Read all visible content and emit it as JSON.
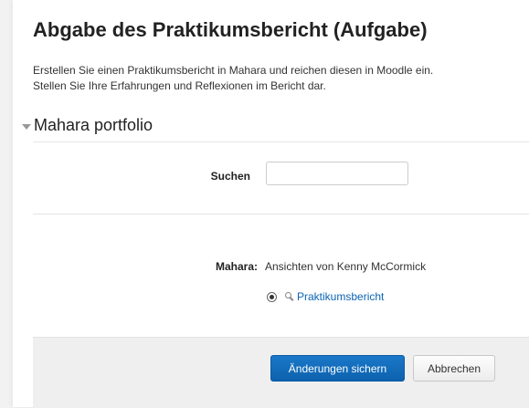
{
  "page": {
    "title": "Abgabe des Praktikumsbericht (Aufgabe)",
    "intro_lines": [
      "Erstellen Sie einen Praktikumsbericht in Mahara und reichen diesen in Moodle ein.",
      "Stellen Sie Ihre Erfahrungen und Reflexionen im Bericht dar."
    ]
  },
  "section": {
    "title": "Mahara portfolio"
  },
  "search": {
    "label": "Suchen",
    "value": "",
    "placeholder": ""
  },
  "mahara": {
    "label": "Mahara:",
    "value": "Ansichten von Kenny McCormick",
    "options": [
      {
        "label": "Praktikumsbericht",
        "selected": true
      }
    ]
  },
  "footer": {
    "save_label": "Änderungen sichern",
    "cancel_label": "Abbrechen"
  },
  "colors": {
    "primary": "#0f6cbf",
    "link": "#0b64b2",
    "footer_bg": "#efefef"
  },
  "icons": {
    "section_toggle": "caret-down-icon",
    "option_preview": "magnifier-icon"
  }
}
